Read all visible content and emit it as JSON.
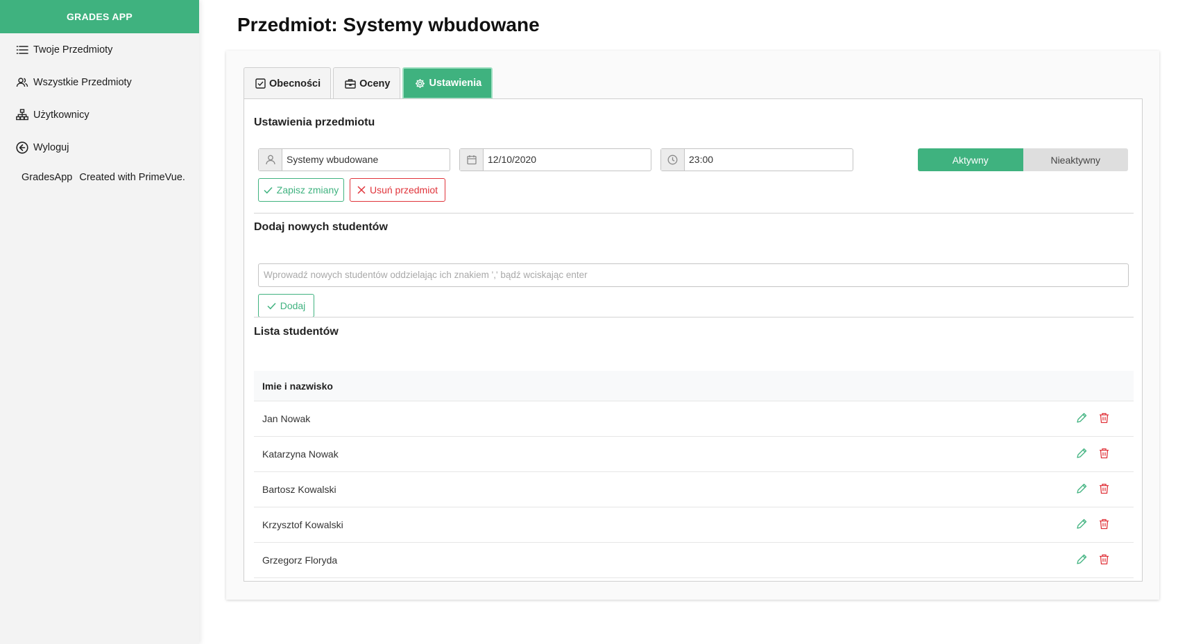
{
  "app": {
    "brand": "GRADES APP",
    "footer_left": "GradesApp",
    "footer_right": "Created with PrimeVue."
  },
  "sidebar": {
    "items": [
      {
        "label": "Twoje Przedmioty",
        "icon": "list-icon"
      },
      {
        "label": "Wszystkie Przedmioty",
        "icon": "users-icon"
      },
      {
        "label": "Użytkownicy",
        "icon": "sitemap-icon"
      },
      {
        "label": "Wyloguj",
        "icon": "arrow-circle-left-icon"
      }
    ]
  },
  "page": {
    "title": "Przedmiot: Systemy wbudowane"
  },
  "tabs": [
    {
      "label": "Obecności",
      "icon": "check-square-icon"
    },
    {
      "label": "Oceny",
      "icon": "briefcase-icon"
    },
    {
      "label": "Ustawienia",
      "icon": "cog-icon",
      "active": true
    }
  ],
  "settings": {
    "title": "Ustawienia przedmiotu",
    "name_value": "Systemy wbudowane",
    "date_value": "12/10/2020",
    "time_value": "23:00",
    "status_options": [
      "Aktywny",
      "Nieaktywny"
    ],
    "status_selected": "Aktywny",
    "save_label": "Zapisz zmiany",
    "delete_label": "Usuń przedmiot"
  },
  "add_students": {
    "title": "Dodaj nowych studentów",
    "placeholder": "Wprowadź nowych studentów oddzielając ich znakiem ',' bądź wciskając enter",
    "add_label": "Dodaj"
  },
  "students": {
    "title": "Lista studentów",
    "column_header": "Imie i nazwisko",
    "rows": [
      "Jan Nowak",
      "Katarzyna Nowak",
      "Bartosz Kowalski",
      "Krzysztof Kowalski",
      "Grzegorz Floryda"
    ]
  },
  "colors": {
    "accent": "#3fb27f",
    "danger": "#e0333a",
    "sidebar_bg": "#f3f3f3"
  }
}
